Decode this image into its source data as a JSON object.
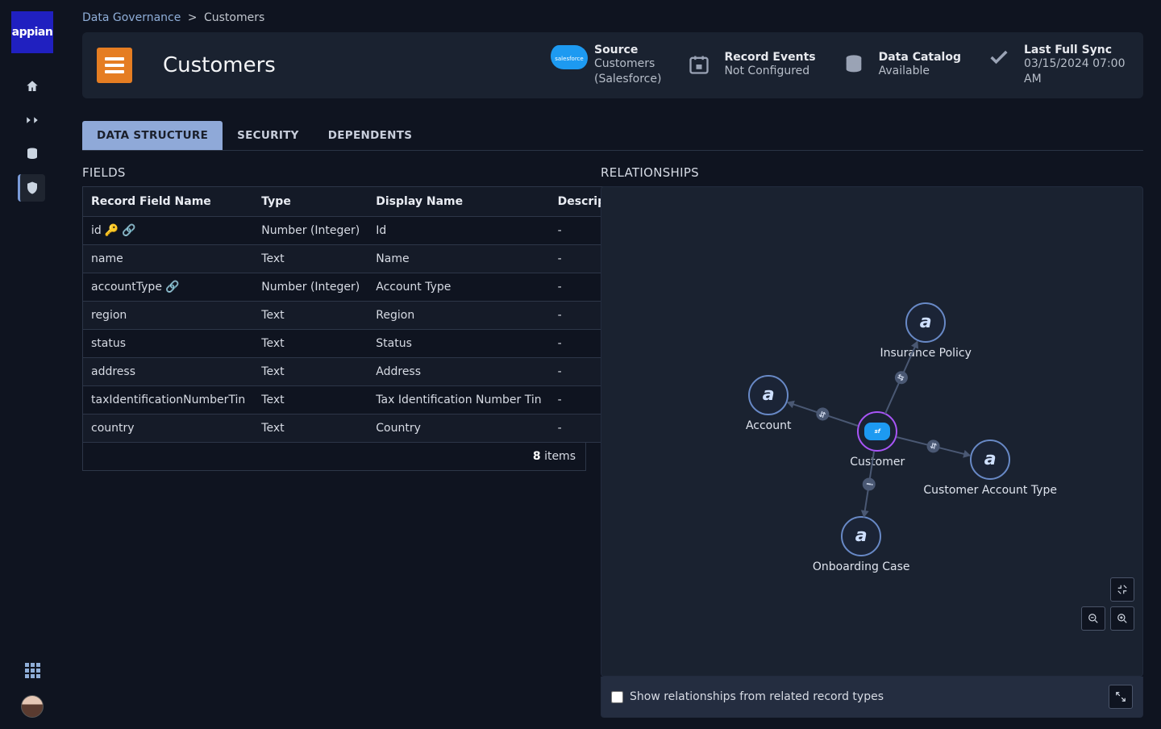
{
  "brand": "appian",
  "breadcrumb": {
    "root": "Data Governance",
    "sep": ">",
    "current": "Customers"
  },
  "header": {
    "title": "Customers",
    "source": {
      "label": "Source",
      "name": "Customers",
      "sub": "(Salesforce)",
      "cloud_text": "salesforce"
    },
    "recordEvents": {
      "label": "Record Events",
      "value": "Not Configured"
    },
    "dataCatalog": {
      "label": "Data Catalog",
      "value": "Available"
    },
    "lastSync": {
      "label": "Last Full Sync",
      "value": "03/15/2024 07:00 AM"
    }
  },
  "tabs": [
    "DATA STRUCTURE",
    "SECURITY",
    "DEPENDENTS"
  ],
  "fields": {
    "title": "FIELDS",
    "headers": [
      "Record Field Name",
      "Type",
      "Display Name",
      "Description"
    ],
    "rows": [
      {
        "name": "id",
        "key": true,
        "link": true,
        "type": "Number (Integer)",
        "display": "Id",
        "desc": "-"
      },
      {
        "name": "name",
        "key": false,
        "link": false,
        "type": "Text",
        "display": "Name",
        "desc": "-"
      },
      {
        "name": "accountType",
        "key": false,
        "link": true,
        "type": "Number (Integer)",
        "display": "Account Type",
        "desc": "-"
      },
      {
        "name": "region",
        "key": false,
        "link": false,
        "type": "Text",
        "display": "Region",
        "desc": "-"
      },
      {
        "name": "status",
        "key": false,
        "link": false,
        "type": "Text",
        "display": "Status",
        "desc": "-"
      },
      {
        "name": "address",
        "key": false,
        "link": false,
        "type": "Text",
        "display": "Address",
        "desc": "-"
      },
      {
        "name": "taxIdentificationNumberTin",
        "key": false,
        "link": false,
        "type": "Text",
        "display": "Tax Identification Number Tin",
        "desc": "-"
      },
      {
        "name": "country",
        "key": false,
        "link": false,
        "type": "Text",
        "display": "Country",
        "desc": "-"
      }
    ],
    "footer_count": "8",
    "footer_suffix": "items"
  },
  "relationships": {
    "title": "RELATIONSHIPS",
    "nodes": {
      "center": "Customer",
      "top": "Insurance Policy",
      "left": "Account",
      "right": "Customer Account Type",
      "bottom": "Onboarding Case"
    },
    "footer_label": "Show relationships from related record types"
  }
}
